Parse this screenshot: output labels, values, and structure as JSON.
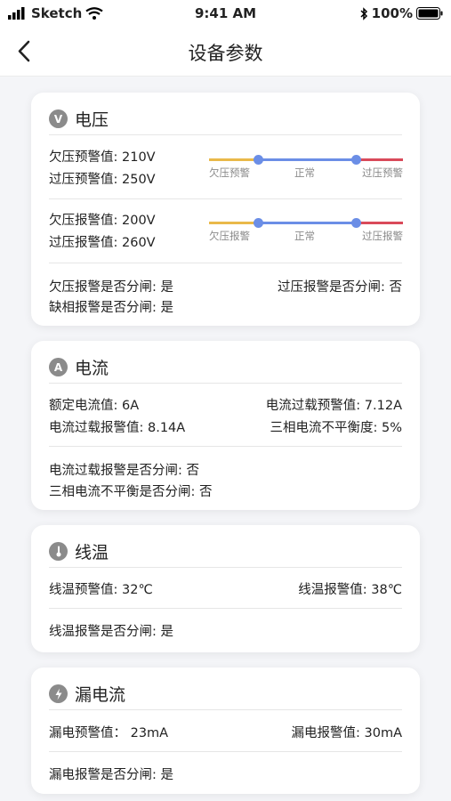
{
  "status_bar": {
    "carrier": "Sketch",
    "time": "9:41 AM",
    "battery": "100%"
  },
  "nav": {
    "title": "设备参数",
    "back_icon": "chevron-left-icon"
  },
  "colors": {
    "under": "#e9b94a",
    "normal": "#6b8ee6",
    "over": "#d94a5a"
  },
  "voltage": {
    "icon": "V",
    "title": "电压",
    "warn_under": "欠压预警值: 210V",
    "warn_over": "过压预警值: 250V",
    "warn_labels": {
      "left": "欠压预警",
      "mid": "正常",
      "right": "过压预警"
    },
    "alarm_under": "欠压报警值: 200V",
    "alarm_over": "过压报警值: 260V",
    "alarm_labels": {
      "left": "欠压报警",
      "mid": "正常",
      "right": "过压报警"
    },
    "trip_under": "欠压报警是否分闸: 是",
    "trip_over": "过压报警是否分闸: 否",
    "trip_phase": "缺相报警是否分闸: 是"
  },
  "current": {
    "icon": "A",
    "title": "电流",
    "rated": "额定电流值: 6A",
    "overload_warn": "电流过载预警值: 7.12A",
    "overload_alarm": "电流过载报警值: 8.14A",
    "imbalance": "三相电流不平衡度: 5%",
    "trip_overload": "电流过载报警是否分闸: 否",
    "trip_imbalance": "三相电流不平衡是否分闸: 否"
  },
  "line_temp": {
    "icon": "thermometer-icon",
    "title": "线温",
    "warn": "线温预警值: 32℃",
    "alarm": "线温报警值: 38℃",
    "trip": "线温报警是否分闸: 是"
  },
  "leakage": {
    "icon": "lightning-icon",
    "title": "漏电流",
    "warn": "漏电预警值：  23mA",
    "alarm": "漏电报警值: 30mA",
    "trip": "漏电报警是否分闸: 是"
  }
}
